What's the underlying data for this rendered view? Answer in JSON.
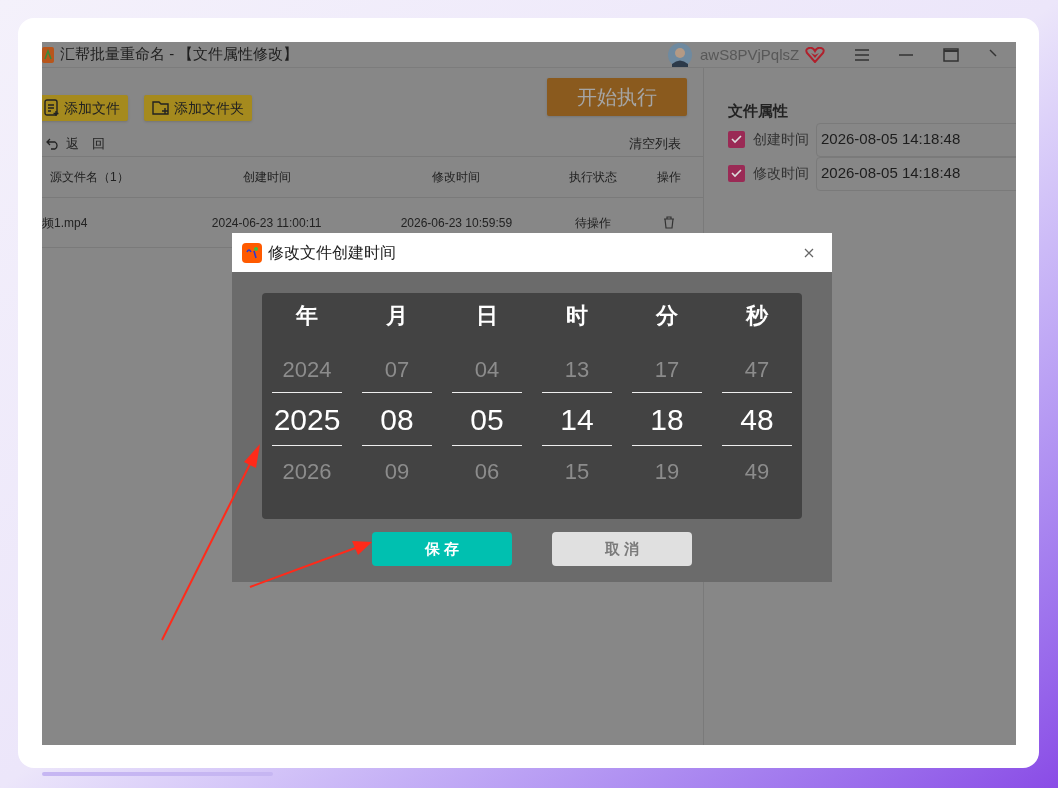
{
  "window": {
    "title": "汇帮批量重命名 - 【文件属性修改】",
    "user": "awS8PVjPqlsZ"
  },
  "toolbar": {
    "buttons": [
      "添加文件",
      "添加文件夹"
    ],
    "start_button": "开始执行"
  },
  "list_bar": {
    "back": "返　回",
    "clear": "清空列表"
  },
  "table": {
    "columns": [
      "源文件名（1）",
      "创建时间",
      "修改时间",
      "执行状态",
      "操作"
    ],
    "rows": [
      {
        "cells": [
          "频1.mp4",
          "2024-06-23 11:00:11",
          "2026-06-23 10:59:59",
          "待操作"
        ]
      }
    ]
  },
  "properties": {
    "title": "文件属性",
    "items": [
      {
        "label": "创建时间",
        "checked": true,
        "value": "2026-08-05 14:18:48"
      },
      {
        "label": "修改时间",
        "checked": true,
        "value": "2026-08-05 14:18:48"
      }
    ]
  },
  "dialog": {
    "title": "修改文件创建时间",
    "columns": [
      {
        "label": "年",
        "previous": "2024",
        "current": "2025",
        "next": "2026"
      },
      {
        "label": "月",
        "previous": "07",
        "current": "08",
        "next": "09"
      },
      {
        "label": "日",
        "previous": "04",
        "current": "05",
        "next": "06"
      },
      {
        "label": "时",
        "previous": "13",
        "current": "14",
        "next": "15"
      },
      {
        "label": "分",
        "previous": "17",
        "current": "18",
        "next": "19"
      },
      {
        "label": "秒",
        "previous": "47",
        "current": "48",
        "next": "49"
      }
    ],
    "save": "保 存",
    "cancel": "取 消"
  }
}
